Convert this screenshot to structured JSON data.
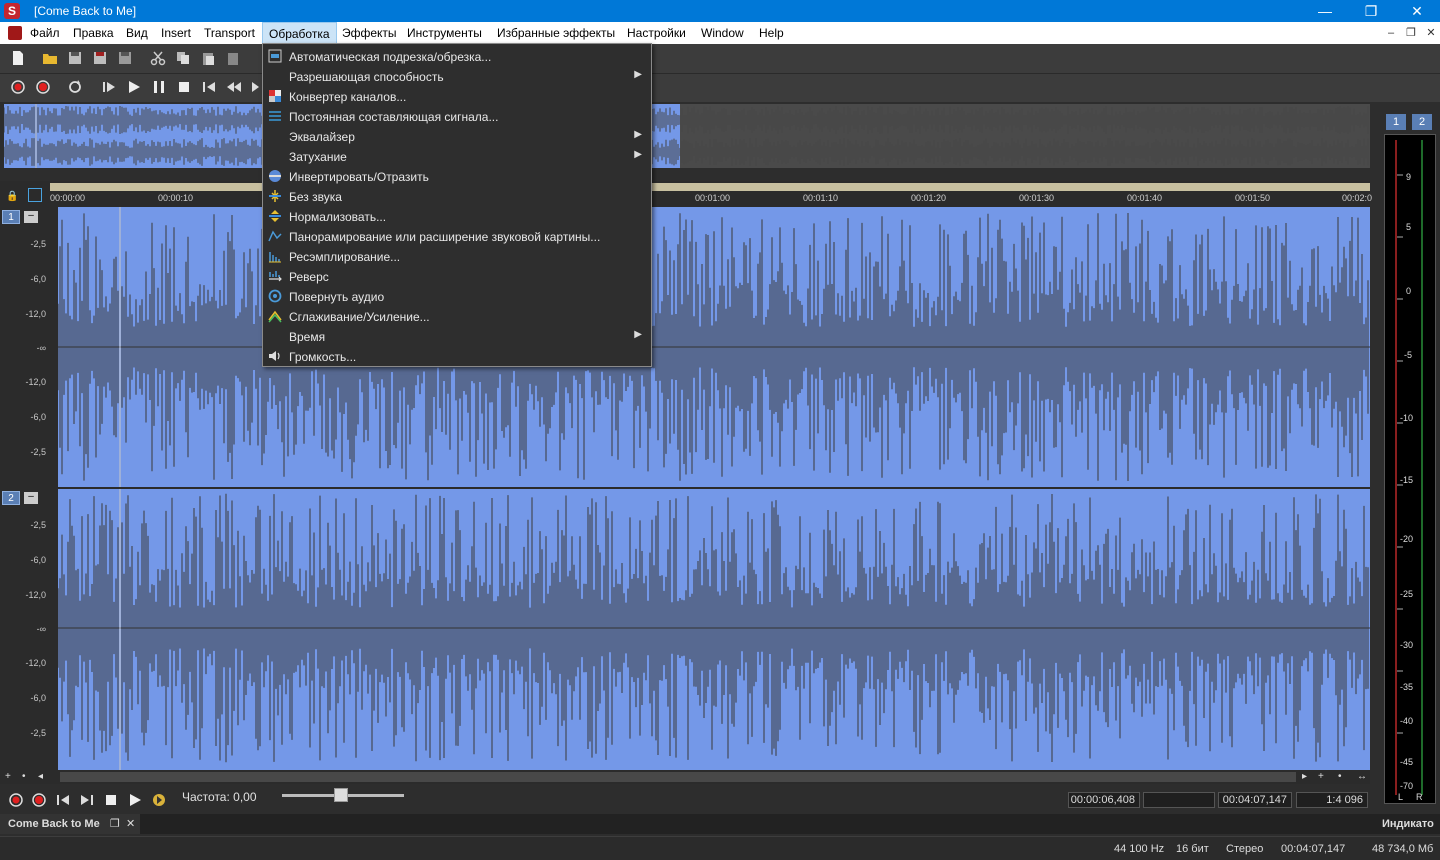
{
  "window": {
    "title": "[Come Back to Me]",
    "app_icon": "S",
    "minimize": "—",
    "maximize": "❐",
    "close": "✕"
  },
  "menubar": {
    "items": [
      {
        "label": "Файл"
      },
      {
        "label": "Правка"
      },
      {
        "label": "Вид"
      },
      {
        "label": "Insert"
      },
      {
        "label": "Transport"
      },
      {
        "label": "Обработка"
      },
      {
        "label": "Эффекты"
      },
      {
        "label": "Инструменты"
      },
      {
        "label": "Избранные эффекты"
      },
      {
        "label": "Настройки"
      },
      {
        "label": "Window"
      },
      {
        "label": "Help"
      }
    ],
    "mdi_controls": [
      "–",
      "❐",
      "✕"
    ]
  },
  "process_menu": {
    "items": [
      {
        "label": "Автоматическая подрезка/обрезка...",
        "icon": "trim-icon",
        "submenu": false
      },
      {
        "label": "Разрешающая способность",
        "icon": "none",
        "submenu": true
      },
      {
        "label": "Конвертер каналов...",
        "icon": "channel-converter-icon",
        "submenu": false
      },
      {
        "label": "Постоянная составляющая сигнала...",
        "icon": "dc-offset-icon",
        "submenu": false
      },
      {
        "label": "Эквалайзер",
        "icon": "none",
        "submenu": true
      },
      {
        "label": "Затухание",
        "icon": "none",
        "submenu": true
      },
      {
        "label": "Инвертировать/Отразить",
        "icon": "invert-icon",
        "submenu": false
      },
      {
        "label": "Без звука",
        "icon": "mute-icon",
        "submenu": false
      },
      {
        "label": "Нормализовать...",
        "icon": "normalize-icon",
        "submenu": false
      },
      {
        "label": "Панорамирование или расширение звуковой картины...",
        "icon": "pan-icon",
        "submenu": false
      },
      {
        "label": "Ресэмплирование...",
        "icon": "resample-icon",
        "submenu": false
      },
      {
        "label": "Реверс",
        "icon": "reverse-icon",
        "submenu": false
      },
      {
        "label": "Повернуть аудио",
        "icon": "rotate-audio-icon",
        "submenu": false
      },
      {
        "label": "Сглаживание/Усиление...",
        "icon": "smooth-enhance-icon",
        "submenu": false
      },
      {
        "label": "Время",
        "icon": "none",
        "submenu": true
      },
      {
        "label": "Громкость...",
        "icon": "volume-icon",
        "submenu": false
      }
    ]
  },
  "ruler": {
    "ticks": [
      "00:00:00",
      "00:00:10",
      "00:01:00",
      "00:01:10",
      "00:01:20",
      "00:01:30",
      "00:01:40",
      "00:01:50",
      "00:02:0"
    ]
  },
  "channels": [
    {
      "badge": "1",
      "scale": [
        "-2,5",
        "-6,0",
        "-12,0",
        "-∞",
        "-12,0",
        "-6,0",
        "-2,5"
      ]
    },
    {
      "badge": "2",
      "scale": [
        "-2,5",
        "-6,0",
        "-12,0",
        "-∞",
        "-12,0",
        "-6,0",
        "-2,5"
      ]
    }
  ],
  "transport": {
    "rate_label": "Частота: 0,00",
    "cursor_pos": "00:00:06,408",
    "selection": "",
    "length": "00:04:07,147",
    "zoom": "1:4 096"
  },
  "document_tab": {
    "label": "Come Back to Me"
  },
  "meters": {
    "label": "Индикато",
    "channel_buttons": [
      "1",
      "2"
    ],
    "scale": [
      "9",
      "5",
      "0",
      "-5",
      "-10",
      "-15",
      "-20",
      "-25",
      "-30",
      "-35",
      "-40",
      "-45",
      "-70"
    ],
    "left": "L",
    "right": "R"
  },
  "status": {
    "sample_rate": "44 100 Hz",
    "bit_depth": "16 бит",
    "channels": "Стерео",
    "duration": "00:04:07,147",
    "disk_space": "48 734,0 Мб"
  },
  "colors": {
    "titlebar": "#0078d7",
    "waveform_bg": "#7498e8",
    "waveform_line": "#3a3a3a",
    "menu_bg": "#2e2e2e"
  }
}
